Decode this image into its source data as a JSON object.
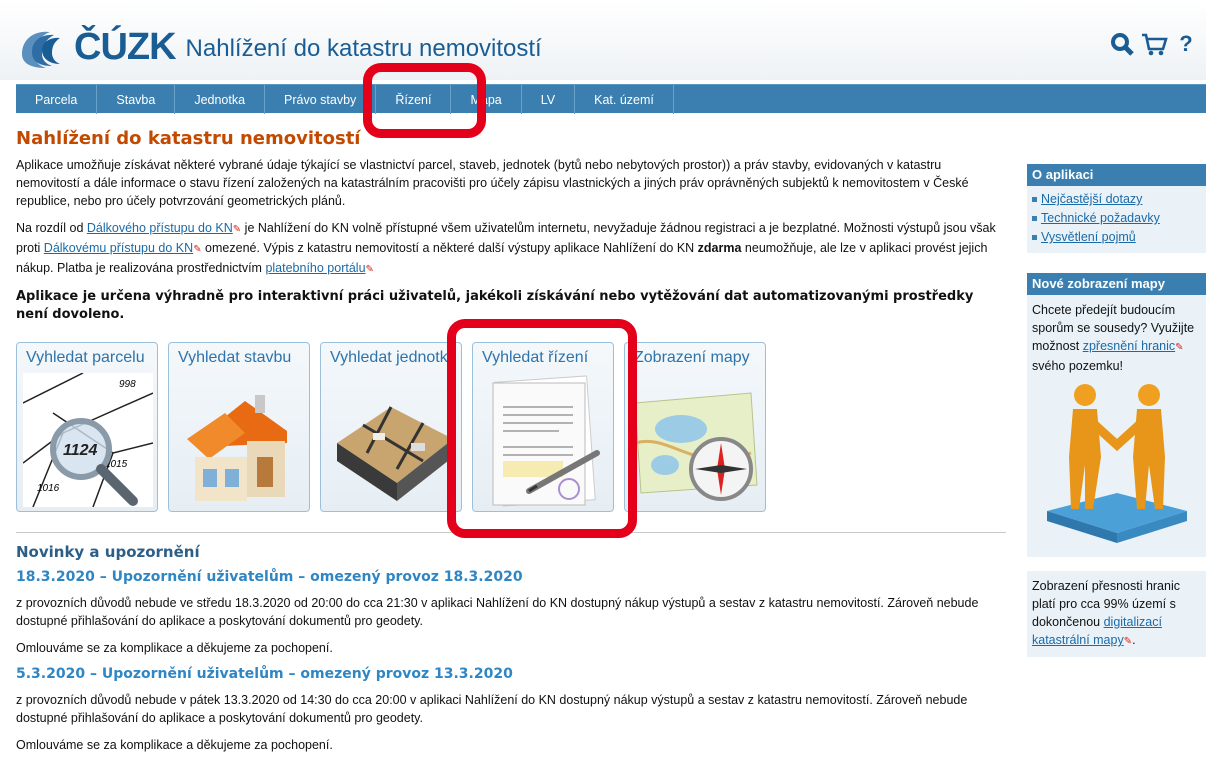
{
  "header": {
    "logo": "ČÚZK",
    "title": "Nahlížení do katastru nemovitostí",
    "tools": [
      {
        "icon": "search-icon",
        "glyph": "🔍"
      },
      {
        "icon": "cart-icon",
        "glyph": "🛒"
      },
      {
        "icon": "help-icon",
        "glyph": "?"
      }
    ]
  },
  "nav": [
    {
      "label": "Parcela"
    },
    {
      "label": "Stavba"
    },
    {
      "label": "Jednotka"
    },
    {
      "label": "Právo stavby"
    },
    {
      "label": "Řízení"
    },
    {
      "label": "Mapa"
    },
    {
      "label": "LV"
    },
    {
      "label": "Kat. území"
    }
  ],
  "main": {
    "title": "Nahlížení do katastru nemovitostí",
    "intro": "Aplikace umožňuje získávat některé vybrané údaje týkající se vlastnictví parcel, staveb, jednotek (bytů nebo nebytových prostor)) a práv stavby, evidovaných v katastru nemovitostí a dále informace o stavu řízení založených na katastrálním pracovišti pro účely zápisu vlastnických a jiných práv oprávněných subjektů k nemovitostem v České republice, nebo pro účely potvrzování geometrických plánů.",
    "p2": {
      "t1": "Na rozdíl od ",
      "link1": "Dálkového přístupu do KN",
      "t2": " je Nahlížení do KN volně přístupné všem uživatelům internetu, nevyžaduje žádnou registraci a je bezplatné. Možnosti výstupů jsou však proti ",
      "link2": "Dálkovému přístupu do KN",
      "t3": " omezené. Výpis z katastru nemovitostí a některé další výstupy aplikace Nahlížení do KN ",
      "bold": "zdarma",
      "t4": " neumožňuje, ale lze v aplikaci provést jejich nákup. Platba je realizována prostřednictvím ",
      "link3": "platebního portálu"
    },
    "notice": "Aplikace je určena výhradně pro interaktivní práci uživatelů, jakékoli získávání nebo vytěžování dat automatizovanými prostředky není dovoleno.",
    "tiles": [
      {
        "label": "Vyhledat parcelu",
        "number": "1124",
        "n1": "998",
        "n2": "1015",
        "n3": "1016"
      },
      {
        "label": "Vyhledat stavbu"
      },
      {
        "label": "Vyhledat jednotku"
      },
      {
        "label": "Vyhledat řízení"
      },
      {
        "label": "Zobrazení mapy"
      }
    ],
    "news_title": "Novinky a upozornění",
    "news": [
      {
        "head": "18.3.2020 – Upozornění uživatelům – omezený provoz 18.3.2020",
        "body": "z provozních důvodů nebude ve středu 18.3.2020 od 20:00 do cca 21:30 v aplikaci Nahlížení do KN dostupný nákup výstupů a sestav z katastru nemovitostí. Zároveň nebude dostupné přihlašování do aplikace a poskytování dokumentů pro geodety.",
        "apology": "Omlouváme se za komplikace a děkujeme za pochopení."
      },
      {
        "head": "5.3.2020 – Upozornění uživatelům – omezený provoz 13.3.2020",
        "body": "z provozních důvodů nebude v pátek 13.3.2020 od 14:30 do cca 20:00 v aplikaci Nahlížení do KN dostupný nákup výstupů a sestav z katastru nemovitostí. Zároveň nebude dostupné přihlašování do aplikace a poskytování dokumentů pro geodety.",
        "apology": "Omlouváme se za komplikace a děkujeme za pochopení."
      }
    ]
  },
  "sidebar": {
    "about_title": "O aplikaci",
    "about_links": [
      "Nejčastější dotazy",
      "Technické požadavky",
      "Vysvětlení pojmů"
    ],
    "map_title": "Nové zobrazení mapy",
    "map_text1": "Chcete předejít budoucím sporům se sousedy? Využijte možnost ",
    "map_link": "zpřesnění hranic",
    "map_text2": " svého pozemku!",
    "acc_text1": "Zobrazení přesnosti hranic platí pro cca 99% území s dokončenou ",
    "acc_link": "digitalizací katastrální mapy",
    "acc_text2": "."
  },
  "colors": {
    "accent": "#3a7fb0",
    "title": "#c24a00",
    "highlight": "#e4001b"
  }
}
